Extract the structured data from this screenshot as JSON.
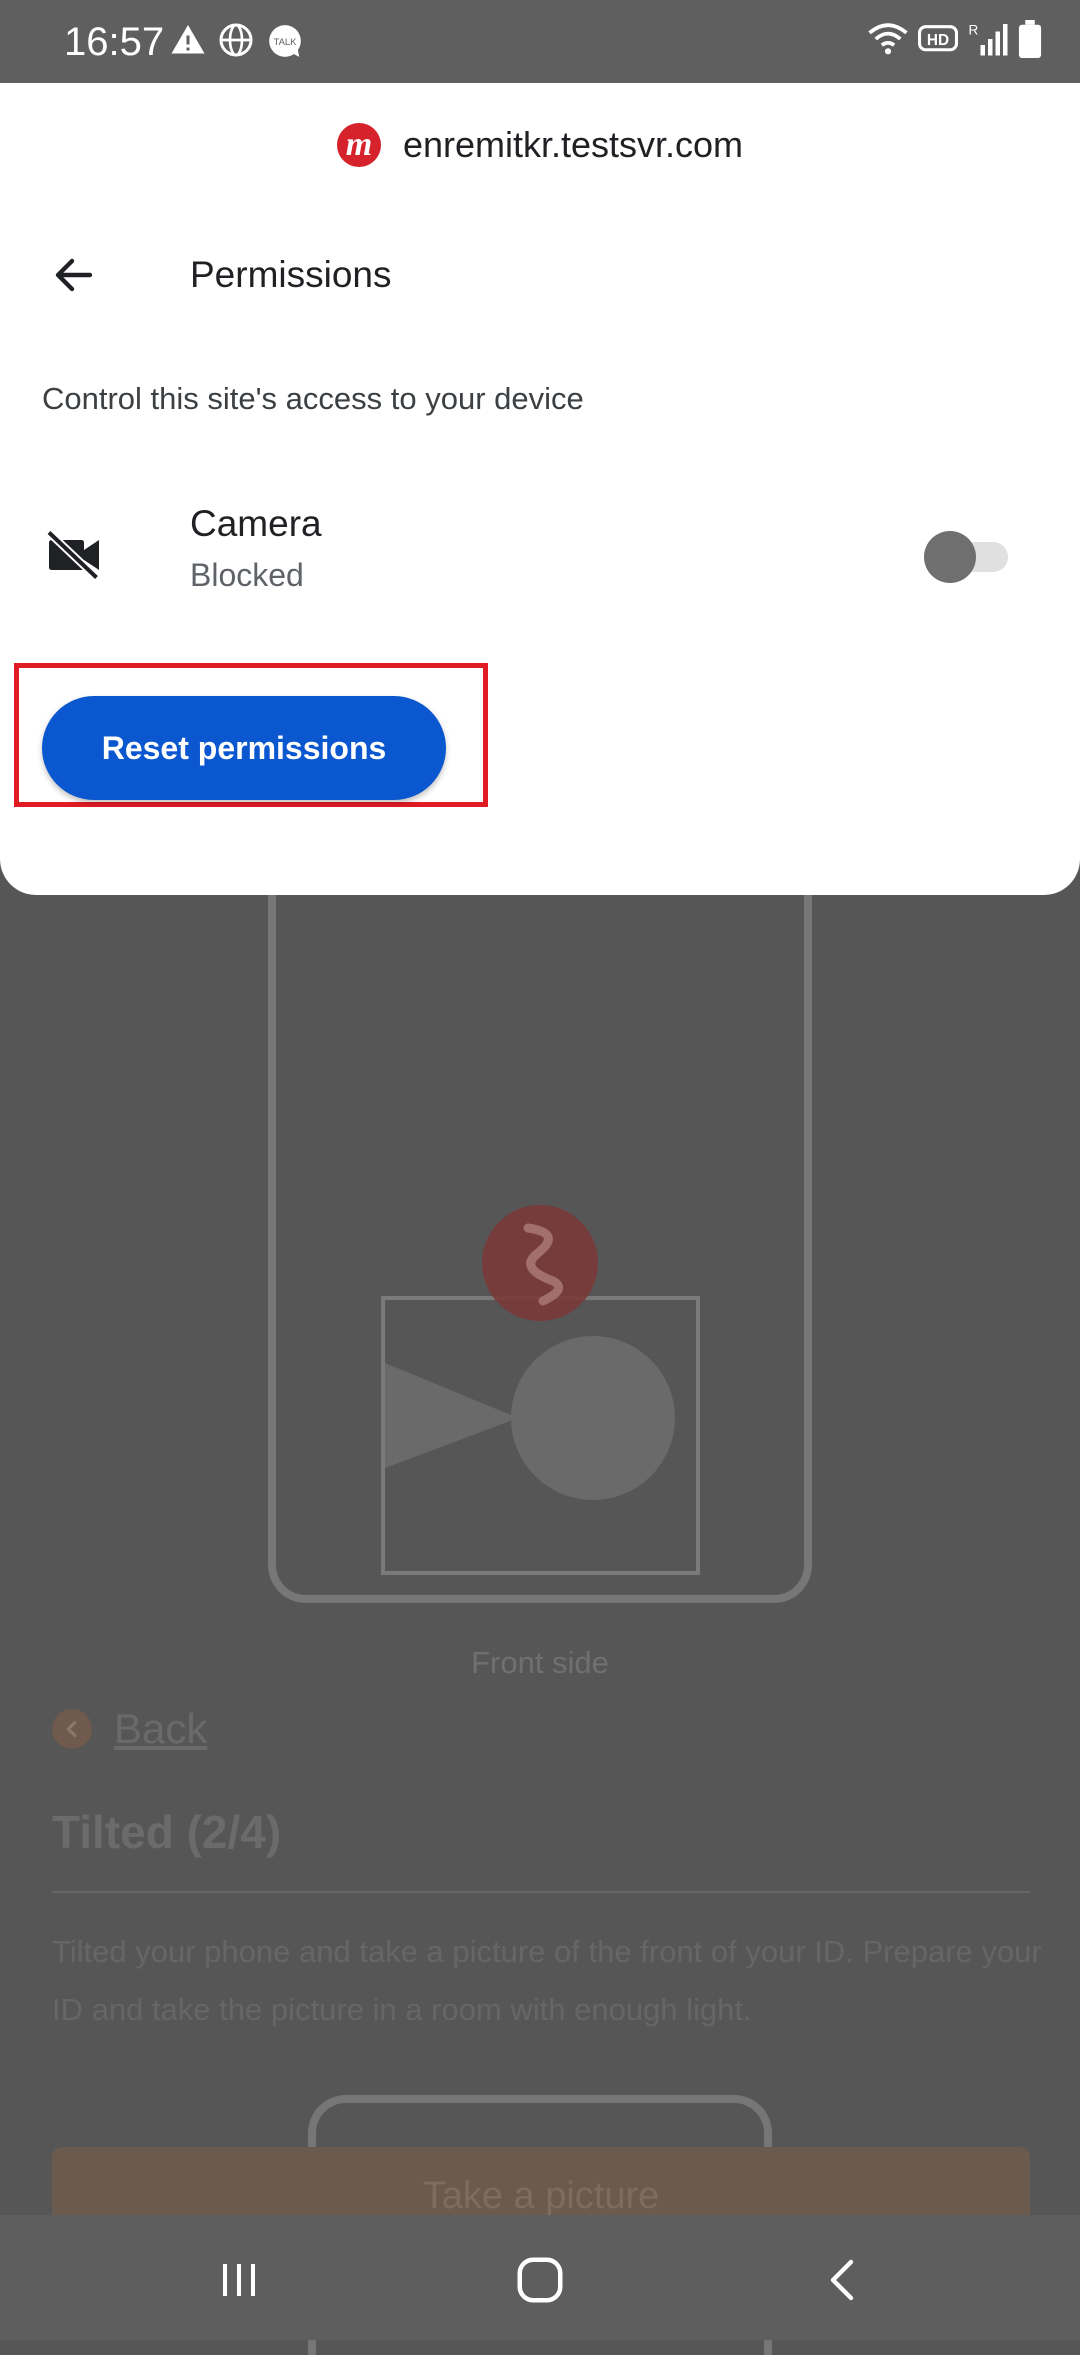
{
  "status_bar": {
    "time": "16:57",
    "left_icons": [
      "warning-icon",
      "globe-icon",
      "talk-icon"
    ],
    "right_icons": [
      "wifi-icon",
      "hd-voice-icon",
      "signal-icon",
      "battery-icon"
    ]
  },
  "permissions_sheet": {
    "site_logo_letter": "m",
    "site_domain": "enremitkr.testsvr.com",
    "title": "Permissions",
    "subtitle": "Control this site's access to your device",
    "camera": {
      "label": "Camera",
      "status": "Blocked",
      "enabled": false
    },
    "reset_button_label": "Reset permissions",
    "colors": {
      "accent": "#0b57d0",
      "highlight": "#e11b24",
      "brand": "#d5222b"
    }
  },
  "background_page": {
    "front_side_caption": "Front side",
    "back_link": "Back",
    "step_title": "Tilted (2/4)",
    "step_description": "Tilted your phone and take a picture of the front of your ID. Prepare your ID and take the picture in a room with enough light.",
    "take_picture_button": "Take a picture"
  },
  "nav_bar": {
    "items": [
      "recents-icon",
      "home-icon",
      "back-icon"
    ]
  }
}
